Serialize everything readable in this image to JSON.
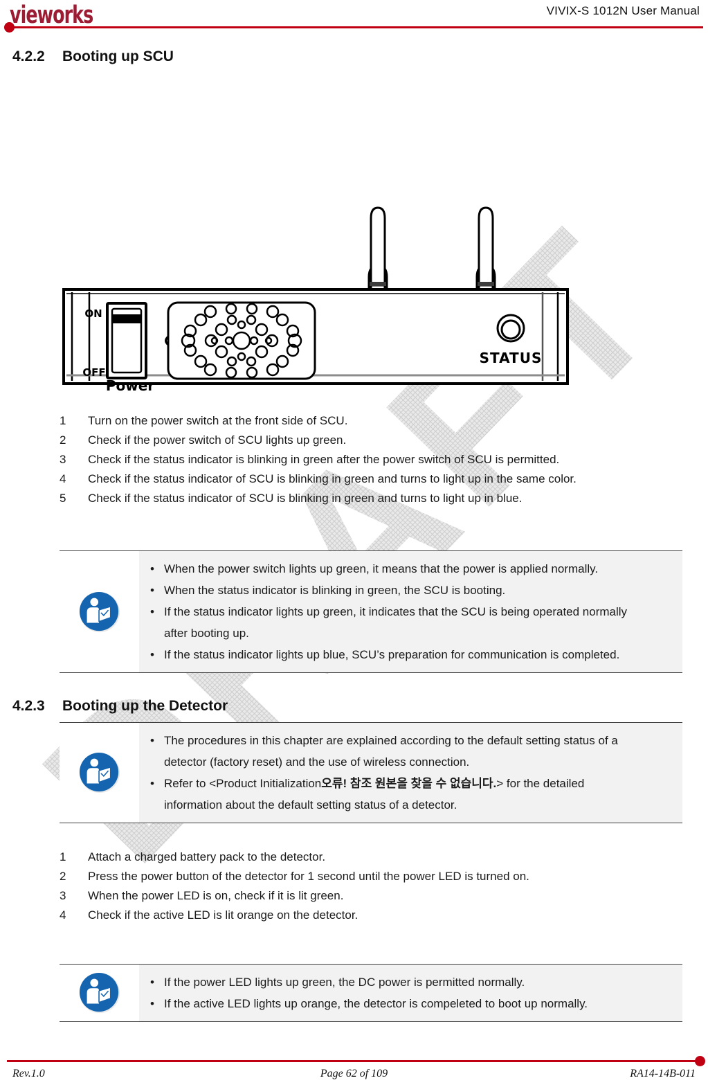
{
  "header": {
    "logo_text": "vieworks",
    "title": "VIVIX-S 1012N User Manual",
    "accent_color": "#c00012"
  },
  "footer": {
    "revision": "Rev.1.0",
    "page": "Page 62 of 109",
    "doc_number": "RA14-14B-011",
    "accent_color": "#c00012"
  },
  "sections": [
    {
      "number": "4.2.2",
      "title": "Booting up SCU"
    },
    {
      "number": "4.2.3",
      "title": "Booting up the Detector"
    }
  ],
  "figure": {
    "caption": "",
    "labels": {
      "on": "ON",
      "off": "OFF",
      "power": "Power",
      "status": "STATUS"
    }
  },
  "scu_steps": [
    {
      "index": "1",
      "text": "Turn on the power switch at the front side of SCU."
    },
    {
      "index": "2",
      "text": "Check if the power switch of SCU lights up green."
    },
    {
      "index": "3",
      "text": "Check if the status indicator is blinking in green after the power switch of SCU is permitted."
    },
    {
      "index": "4",
      "text": "Check if the status indicator of SCU is blinking in green and turns to light up in the same color."
    },
    {
      "index": "5",
      "text": "Check if the status indicator of SCU is blinking in green and turns to light up in blue."
    }
  ],
  "scu_note": {
    "icon": "refer-to-instruction-manual-icon",
    "lines": [
      {
        "bullet": true,
        "text": "When the power switch lights up green, it means that the power is applied normally."
      },
      {
        "bullet": true,
        "text": "When the status indicator is blinking in green, the SCU is booting."
      },
      {
        "bullet": true,
        "text": "If the status indicator lights up green, it indicates that the SCU is being operated normally"
      },
      {
        "bullet": false,
        "text": "after booting up."
      },
      {
        "bullet": true,
        "text": "If the status indicator lights up blue, SCU’s preparation for communication is completed."
      }
    ]
  },
  "detector_note": {
    "icon": "refer-to-instruction-manual-icon",
    "lines": [
      {
        "bullet": true,
        "text": "The procedures in this chapter are explained according to the default setting status of a"
      },
      {
        "bullet": false,
        "text": "detector (factory reset) and the use of wireless connection."
      },
      {
        "bullet": true,
        "text_prefix": "Refer to <Product Initialization",
        "text_korean": "오류! 참조 원본을 찾을 수 없습니다.",
        "text_suffix": "> for the detailed"
      },
      {
        "bullet": false,
        "text": "information about the default setting status of a detector."
      }
    ]
  },
  "detector_steps": [
    {
      "index": "1",
      "text": "Attach a charged battery pack to the detector."
    },
    {
      "index": "2",
      "text": "Press the power button of the detector for 1 second until the power LED is turned on."
    },
    {
      "index": "3",
      "text": "When the power LED is on, check if it is lit green."
    },
    {
      "index": "4",
      "text": "Check if the active LED is lit orange on the detector."
    }
  ],
  "detector_result_note": {
    "icon": "refer-to-instruction-manual-icon",
    "lines": [
      {
        "bullet": true,
        "text": "If the power LED lights up green, the DC power is permitted normally."
      },
      {
        "bullet": true,
        "text": "If the active LED lights up orange, the detector is compeleted to boot up normally."
      }
    ]
  },
  "watermark": {
    "text": "DRAFT"
  }
}
